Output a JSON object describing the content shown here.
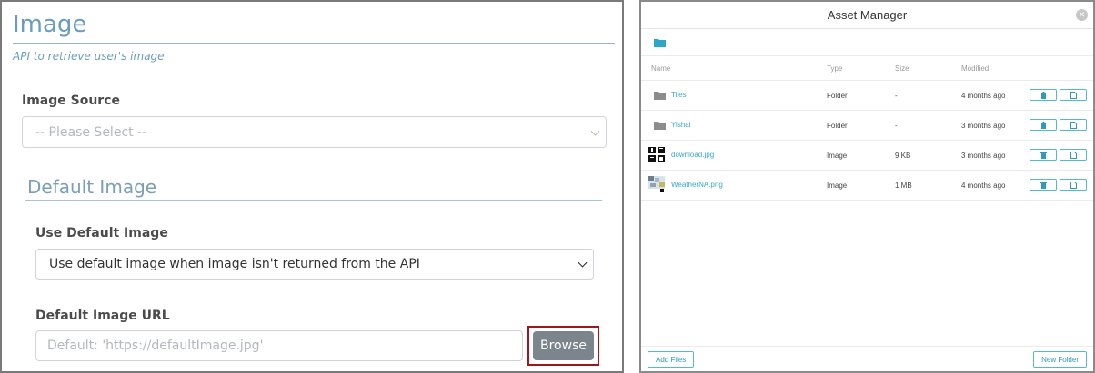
{
  "image_form": {
    "title": "Image",
    "subtitle": "API to retrieve user's image",
    "image_source": {
      "label": "Image Source",
      "value": "-- Please Select --"
    },
    "default_section": {
      "title": "Default Image"
    },
    "use_default": {
      "label": "Use Default Image",
      "value": "Use default image when image isn't returned from the API"
    },
    "default_url": {
      "label": "Default Image URL",
      "placeholder": "Default: 'https://defaultImage.jpg'"
    },
    "browse_label": "Browse",
    "colors": {
      "accent": "#6a9cc0",
      "browse_highlight": "#a0161b",
      "browse_bg": "#7d858c"
    }
  },
  "asset_manager": {
    "title": "Asset Manager",
    "close_icon": "close-icon",
    "columns": {
      "name": "Name",
      "type": "Type",
      "size": "Size",
      "modified": "Modified"
    },
    "rows": [
      {
        "name": "Tiles",
        "type": "Folder",
        "size": "-",
        "modified": "4 months ago",
        "icon": "folder-icon"
      },
      {
        "name": "Yishai",
        "type": "Folder",
        "size": "-",
        "modified": "3 months ago",
        "icon": "folder-icon"
      },
      {
        "name": "download.jpg",
        "type": "Image",
        "size": "9 KB",
        "modified": "3 months ago",
        "icon": "image-thumbnail"
      },
      {
        "name": "WeatherNA.png",
        "type": "Image",
        "size": "1 MB",
        "modified": "4 months ago",
        "icon": "image-thumbnail"
      }
    ],
    "footer": {
      "add_files": "Add Files",
      "new_folder": "New Folder"
    },
    "colors": {
      "accent": "#3aa7c8"
    }
  }
}
